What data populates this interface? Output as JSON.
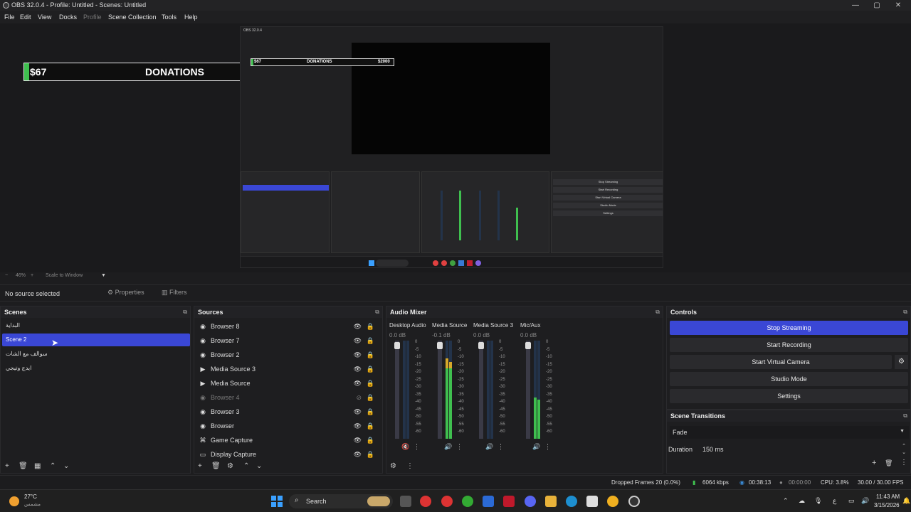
{
  "window": {
    "title": "OBS 32.0.4 - Profile: Untitled - Scenes: Untitled"
  },
  "menu": [
    "File",
    "Edit",
    "View",
    "Docks",
    "Profile",
    "Scene Collection",
    "Tools",
    "Help"
  ],
  "overlay": {
    "left_value": "$67",
    "label": "DONATIONS",
    "right_value": "$2000"
  },
  "zoom": {
    "minus": "−",
    "level": "46%",
    "plus": "+",
    "mode": "Scale to Window"
  },
  "source_toolbar": {
    "no_source": "No source selected",
    "properties": "Properties",
    "filters": "Filters"
  },
  "scenes": {
    "title": "Scenes",
    "items": [
      "البداية",
      "Scene 2",
      "سوالف مع الشات",
      "ايدج وتيجي"
    ],
    "selected_index": 1
  },
  "sources": {
    "title": "Sources",
    "items": [
      {
        "name": "Browser 8",
        "icon": "globe-icon",
        "visible": true
      },
      {
        "name": "Browser 7",
        "icon": "globe-icon",
        "visible": true
      },
      {
        "name": "Browser 2",
        "icon": "globe-icon",
        "visible": true
      },
      {
        "name": "Media Source 3",
        "icon": "play-icon",
        "visible": true
      },
      {
        "name": "Media Source",
        "icon": "play-icon",
        "visible": true
      },
      {
        "name": "Browser 4",
        "icon": "globe-icon",
        "visible": false
      },
      {
        "name": "Browser 3",
        "icon": "globe-icon",
        "visible": true
      },
      {
        "name": "Browser",
        "icon": "globe-icon",
        "visible": true
      },
      {
        "name": "Game Capture",
        "icon": "gamepad-icon",
        "visible": true
      },
      {
        "name": "Display Capture",
        "icon": "monitor-icon",
        "visible": true
      }
    ]
  },
  "audio_mixer": {
    "title": "Audio Mixer",
    "channels": [
      {
        "name": "Desktop Audio",
        "db": "0.0 dB",
        "level": 0.0,
        "muted": true
      },
      {
        "name": "Media Source",
        "db": "-0.1 dB",
        "level": 0.82,
        "muted": false
      },
      {
        "name": "Media Source 3",
        "db": "0.0 dB",
        "level": 0.0,
        "muted": false
      },
      {
        "name": "Mic/Aux",
        "db": "0.0 dB",
        "level": 0.42,
        "muted": false
      }
    ],
    "scale": [
      "0",
      "-5",
      "-10",
      "-15",
      "-20",
      "-25",
      "-30",
      "-35",
      "-40",
      "-45",
      "-50",
      "-55",
      "-60"
    ]
  },
  "controls": {
    "title": "Controls",
    "stop_streaming": "Stop Streaming",
    "start_recording": "Start Recording",
    "start_virtual_camera": "Start Virtual Camera",
    "studio_mode": "Studio Mode",
    "settings": "Settings"
  },
  "scene_transitions": {
    "title": "Scene Transitions",
    "transition": "Fade",
    "duration_label": "Duration",
    "duration_value": "150 ms"
  },
  "status": {
    "dropped_frames": "Dropped Frames 20 (0.0%)",
    "bitrate": "6064 kbps",
    "stream_time": "00:38:13",
    "record_time": "00:00:00",
    "cpu": "CPU: 3.8%",
    "fps": "30.00 / 30.00 FPS"
  },
  "taskbar": {
    "weather_temp": "27°C",
    "weather_desc": "مشمس",
    "search": "Search",
    "time": "11:43 AM",
    "date": "3/15/2026"
  },
  "colors": {
    "accent": "#3a47d5",
    "meter_green": "#3fbf4f",
    "meter_yellow": "#d6a82a",
    "meter_red": "#c0303a"
  }
}
